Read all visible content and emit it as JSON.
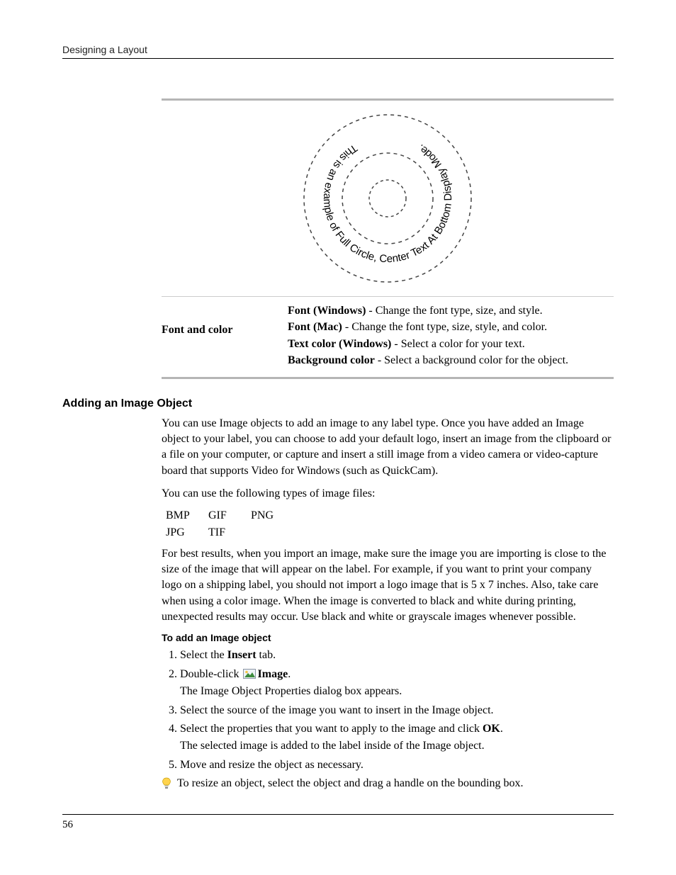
{
  "header": {
    "title": "Designing a Layout"
  },
  "figure": {
    "circular_text": "This is an example of Full Circle, Center Text At Bottom Display Mode."
  },
  "font_color_table": {
    "label": "Font and color",
    "items": [
      {
        "term": "Font (Windows)",
        "desc": " - Change the font type, size, and style."
      },
      {
        "term": "Font (Mac)",
        "desc": " - Change the font type, size, style, and color."
      },
      {
        "term": "Text color (Windows)",
        "desc": " - Select a color for your text."
      },
      {
        "term": "Background color",
        "desc": " - Select a background color for the object."
      }
    ]
  },
  "section": {
    "heading": "Adding an Image Object",
    "para1": "You can use Image objects to add an image to any label type. Once you have added an Image object to your label, you can choose to add your default logo, insert an image from the clipboard or a file on your computer, or capture and insert a still image from a video camera or video-capture board that supports Video for Windows (such as QuickCam).",
    "para2": "You can use the following types of image files:",
    "file_types": [
      "BMP",
      "GIF",
      "PNG",
      "JPG",
      "TIF"
    ],
    "para3": "For best results, when you import an image, make sure the image you are importing is close to the size of the image that will appear on the label. For example, if you want to print your company logo on a shipping label, you should not import a logo image that is 5 x 7 inches. Also, take care when using a color image. When the image is converted to black and white during printing, unexpected results may occur. Use black and white or grayscale images whenever possible.",
    "subheading": "To add an Image object",
    "steps": {
      "s1_prefix": "Select the ",
      "s1_bold": "Insert",
      "s1_suffix": " tab.",
      "s2_prefix": "Double-click ",
      "s2_bold": "Image",
      "s2_suffix": ".",
      "s2_sub": "The Image Object Properties dialog box appears.",
      "s3": "Select the source of the image you want to insert in the Image object.",
      "s4_prefix": "Select the properties that you want to apply to the image and click ",
      "s4_bold": "OK",
      "s4_suffix": ".",
      "s4_sub": "The selected image is added to the label inside of the Image object.",
      "s5": "Move and resize the object as necessary."
    },
    "tip": "To resize an object, select the object and drag a handle on the bounding box."
  },
  "page_number": "56"
}
